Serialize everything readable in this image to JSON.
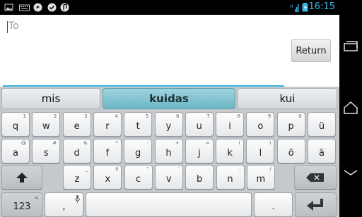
{
  "status": {
    "time": "16:15",
    "icons": [
      "image-icon",
      "keyboard-icon",
      "talk-icon",
      "chat-icon",
      "music-icon",
      "signal-icon",
      "battery-icon"
    ]
  },
  "composer": {
    "to_placeholder": "To",
    "return_label": "Return"
  },
  "suggestions": [
    "mis",
    "kuidas",
    "kui"
  ],
  "keyboard": {
    "row1": [
      {
        "label": "q",
        "hint": "1"
      },
      {
        "label": "w",
        "hint": "2"
      },
      {
        "label": "e",
        "hint": "3"
      },
      {
        "label": "r",
        "hint": "4"
      },
      {
        "label": "t",
        "hint": "5"
      },
      {
        "label": "y",
        "hint": "6"
      },
      {
        "label": "u",
        "hint": "7"
      },
      {
        "label": "i",
        "hint": "8"
      },
      {
        "label": "o",
        "hint": "9"
      },
      {
        "label": "p",
        "hint": "0"
      },
      {
        "label": "ü",
        "hint": ""
      }
    ],
    "row2": [
      {
        "label": "a",
        "hint": "@"
      },
      {
        "label": "s",
        "hint": "#"
      },
      {
        "label": "d",
        "hint": "&"
      },
      {
        "label": "f",
        "hint": "*"
      },
      {
        "label": "g",
        "hint": "-"
      },
      {
        "label": "h",
        "hint": "+"
      },
      {
        "label": "j",
        "hint": "="
      },
      {
        "label": "k",
        "hint": "("
      },
      {
        "label": "l",
        "hint": ")"
      },
      {
        "label": "õ",
        "hint": ""
      },
      {
        "label": "ä",
        "hint": ""
      }
    ],
    "row3": [
      {
        "label": "z",
        "hint": "_"
      },
      {
        "label": "x",
        "hint": "$"
      },
      {
        "label": "c",
        "hint": "\""
      },
      {
        "label": "v",
        "hint": "'"
      },
      {
        "label": "b",
        "hint": ":"
      },
      {
        "label": "n",
        "hint": ";"
      },
      {
        "label": "m",
        "hint": "/"
      }
    ],
    "numbers_label": "123",
    "comma_label": ",",
    "period_label": "."
  },
  "colors": {
    "accent": "#33b5e5",
    "suggestion_active": "#7cc0cc",
    "keyboard_bg": "#c5c8cc"
  }
}
